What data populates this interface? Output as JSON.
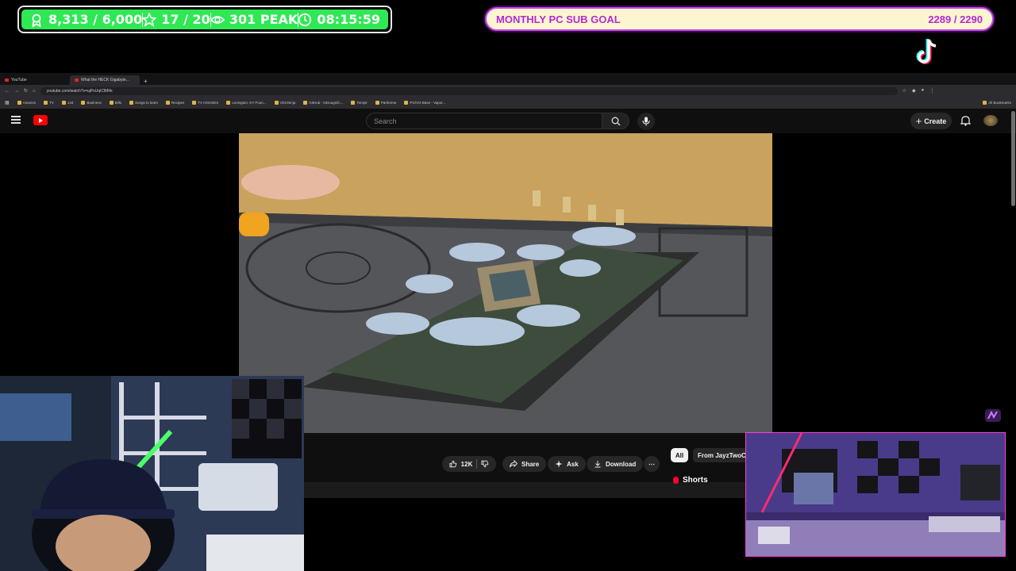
{
  "overlay": {
    "stats": [
      {
        "icon": "badge-icon",
        "value": "8,313 / 6,000"
      },
      {
        "icon": "star-icon",
        "value": "17 / 20"
      },
      {
        "icon": "eye-icon",
        "value": "301 PEAK"
      },
      {
        "icon": "clock-icon",
        "value": "08:15:59"
      }
    ],
    "goal": {
      "label": "MONTHLY PC SUB GOAL",
      "progress": "2289 / 2290",
      "current": 2289,
      "target": 2290
    },
    "colors": {
      "stats_bg": "#2ee854",
      "goal_bg": "#fdf5cf",
      "goal_accent": "#c845f0"
    }
  },
  "browser": {
    "tabs": [
      {
        "title": "YouTube",
        "active": false
      },
      {
        "title": "What the HECK Gigabyte...",
        "active": true
      }
    ],
    "new_tab": "+",
    "url": "youtube.com/watch?v=ujPsUqIClMhk",
    "bookmarks": [
      "Amazon",
      "TV",
      "144",
      "Business",
      "Bills",
      "Songs to learn",
      "Recipes",
      "TV HOUSES",
      "Lexington, KY Foun...",
      "VDCNinja",
      "GitHub - InDougs/C...",
      "Tempir",
      "Panforme",
      "PG/VG Base - Vapor..."
    ],
    "all_bookmarks": "All Bookmarks"
  },
  "youtube": {
    "search_placeholder": "Search",
    "create_label": "Create",
    "likes": "12K",
    "share_label": "Share",
    "ask_label": "Ask",
    "download_label": "Download",
    "chips": {
      "all": "All",
      "from": "From JayzTwoCents"
    },
    "shorts_label": "Shorts"
  }
}
